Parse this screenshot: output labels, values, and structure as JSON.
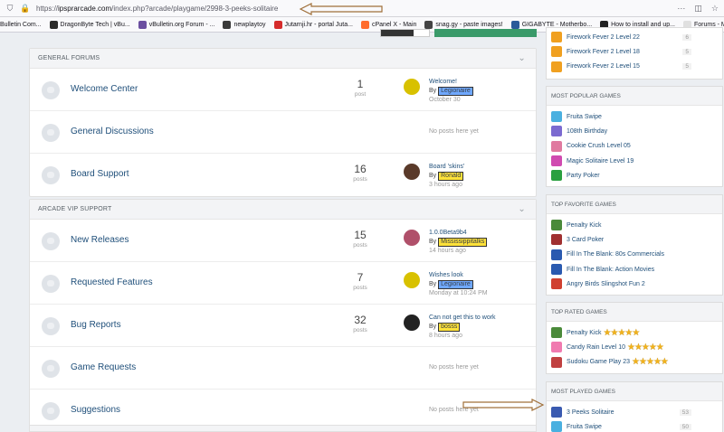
{
  "browser": {
    "url_prefix": "https://",
    "url_host": "ipsprarcade.com",
    "url_path": "/index.php?arcade/playgame/2998-3-peeks-solitaire"
  },
  "bookmarks": [
    {
      "label": "Bulletin Com...",
      "color": "#ffffff"
    },
    {
      "label": "DragonByte Tech | vBu...",
      "color": "#2b2b2b"
    },
    {
      "label": "vBulletin.org Forum - ...",
      "color": "#6b4fa0"
    },
    {
      "label": "newplaytoy",
      "color": "#3a3a3a"
    },
    {
      "label": "Jutarnji.hr - portal Juta...",
      "color": "#d52b2b"
    },
    {
      "label": "cPanel X - Main",
      "color": "#ff6c2c"
    },
    {
      "label": "snag.gy - paste images!",
      "color": "#444444"
    },
    {
      "label": "GIGABYTE - Motherbo...",
      "color": "#2a5a9a"
    },
    {
      "label": "How to install and up...",
      "color": "#222222"
    },
    {
      "label": "Forums - Mississippita...",
      "color": "#e0e0e0"
    }
  ],
  "sections": [
    {
      "title": "General Forums",
      "forums": [
        {
          "name": "Welcome Center",
          "count": "1",
          "count_label": "post",
          "last_title": "Welcome!",
          "by": "By",
          "user": "Legionaire",
          "user_bg": "#6fa8ff",
          "time": "October 30",
          "avatar": "#d8c100",
          "avatar_icon": "emoji-face-avatar"
        },
        {
          "name": "General Discussions",
          "no_posts": "No posts here yet"
        },
        {
          "name": "Board Support",
          "count": "16",
          "count_label": "posts",
          "last_title": "Board 'skins'",
          "by": "By",
          "user": "Ronald",
          "user_bg": "#ffe23a",
          "time": "3 hours ago",
          "avatar": "#5a3a2a",
          "avatar_icon": "portrait-avatar"
        }
      ]
    },
    {
      "title": "Arcade VIP Support",
      "forums": [
        {
          "name": "New Releases",
          "count": "15",
          "count_label": "posts",
          "last_title": "1.0.0Beta9b4",
          "by": "By",
          "user": "Mississippitalks",
          "user_bg": "#ffe23a",
          "time": "14 hours ago",
          "avatar": "#b0506a",
          "avatar_icon": "flower-avatar"
        },
        {
          "name": "Requested Features",
          "count": "7",
          "count_label": "posts",
          "last_title": "Wishes look",
          "by": "By",
          "user": "Legionaire",
          "user_bg": "#6fa8ff",
          "time": "Monday at 10:24 PM",
          "avatar": "#d8c100",
          "avatar_icon": "emoji-face-avatar"
        },
        {
          "name": "Bug Reports",
          "count": "32",
          "count_label": "posts",
          "last_title": "Can not get this to work",
          "by": "By",
          "user": "bosss",
          "user_bg": "#ffe23a",
          "time": "8 hours ago",
          "avatar": "#222222",
          "avatar_icon": "boss-logo-avatar"
        },
        {
          "name": "Game Requests",
          "no_posts": "No posts here yet"
        },
        {
          "name": "Suggestions",
          "no_posts": "No posts here yet"
        }
      ]
    }
  ],
  "sidebar": {
    "recent": [
      {
        "name": "Firework Fever 2 Level 22",
        "count": "6",
        "color": "#f0a020"
      },
      {
        "name": "Firework Fever 2 Level 18",
        "count": "5",
        "color": "#f0a020"
      },
      {
        "name": "Firework Fever 2 Level 15",
        "count": "5",
        "color": "#f0a020"
      }
    ],
    "popular": {
      "title": "Most Popular Games",
      "items": [
        {
          "name": "Fruita Swipe",
          "color": "#4ab0e0"
        },
        {
          "name": "108th Birthday",
          "color": "#7b6ad0"
        },
        {
          "name": "Cookie Crush Level 05",
          "color": "#e07aa0"
        },
        {
          "name": "Magic Solitaire Level 19",
          "color": "#d04ab0"
        },
        {
          "name": "Party Poker",
          "color": "#2aa040"
        }
      ]
    },
    "favorite": {
      "title": "Top Favorite Games",
      "items": [
        {
          "name": "Penalty Kick",
          "color": "#4a8a3a"
        },
        {
          "name": "3 Card Poker",
          "color": "#a03030"
        },
        {
          "name": "Fill In The Blank: 80s Commercials",
          "color": "#2a5ab0"
        },
        {
          "name": "Fill In The Blank: Action Movies",
          "color": "#2a5ab0"
        },
        {
          "name": "Angry Birds Slingshot Fun 2",
          "color": "#d04030"
        }
      ]
    },
    "rated": {
      "title": "Top Rated Games",
      "items": [
        {
          "name": "Penalty Kick",
          "color": "#4a8a3a",
          "stars": "★★★★★"
        },
        {
          "name": "Candy Rain Level 10",
          "color": "#f07ab0",
          "stars": "★★★★★"
        },
        {
          "name": "Sudoku Game Play 23",
          "color": "#c04040",
          "stars": "★★★★★"
        }
      ]
    },
    "played": {
      "title": "Most Played Games",
      "items": [
        {
          "name": "3 Peeks Solitaire",
          "count": "53",
          "color": "#3a5ab0"
        },
        {
          "name": "Fruita Swipe",
          "count": "50",
          "color": "#4ab0e0"
        }
      ]
    }
  }
}
